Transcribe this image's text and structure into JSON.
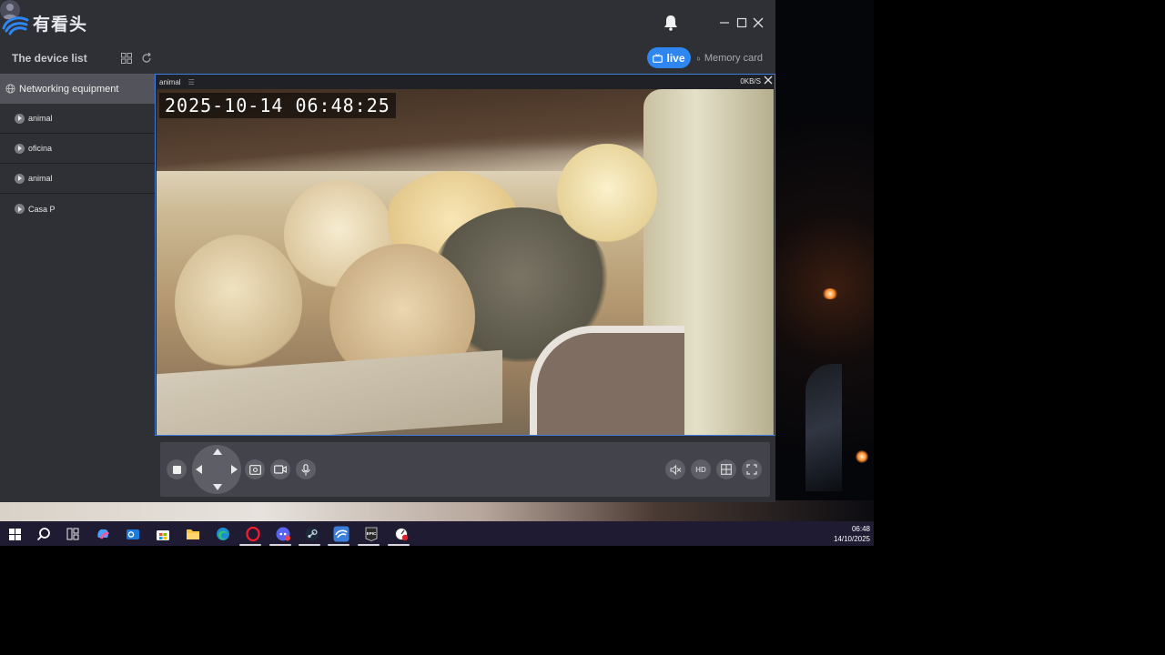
{
  "app": {
    "logo_text": "有看头",
    "window_controls": {
      "minimize": "minimize-icon",
      "maximize": "maximize-icon",
      "close": "close-icon"
    }
  },
  "subbar": {
    "device_list_title": "The device list",
    "live_label": "live",
    "memory_label": "Memory card"
  },
  "sidebar": {
    "group_label": "Networking equipment",
    "devices": [
      {
        "label": "animal"
      },
      {
        "label": "oficina"
      },
      {
        "label": "animal"
      },
      {
        "label": "Casa P"
      }
    ]
  },
  "video": {
    "channel_name": "animal",
    "bitrate": "0KB/S",
    "osd_timestamp": "2025-10-14  06:48:25"
  },
  "controls": {
    "hd_label": "HD"
  },
  "taskbar": {
    "time": "06:48",
    "date": "14/10/2025"
  },
  "colors": {
    "accent": "#2f86f0",
    "window_bg": "#2f3036",
    "taskbar_bg": "#1e1b33"
  }
}
